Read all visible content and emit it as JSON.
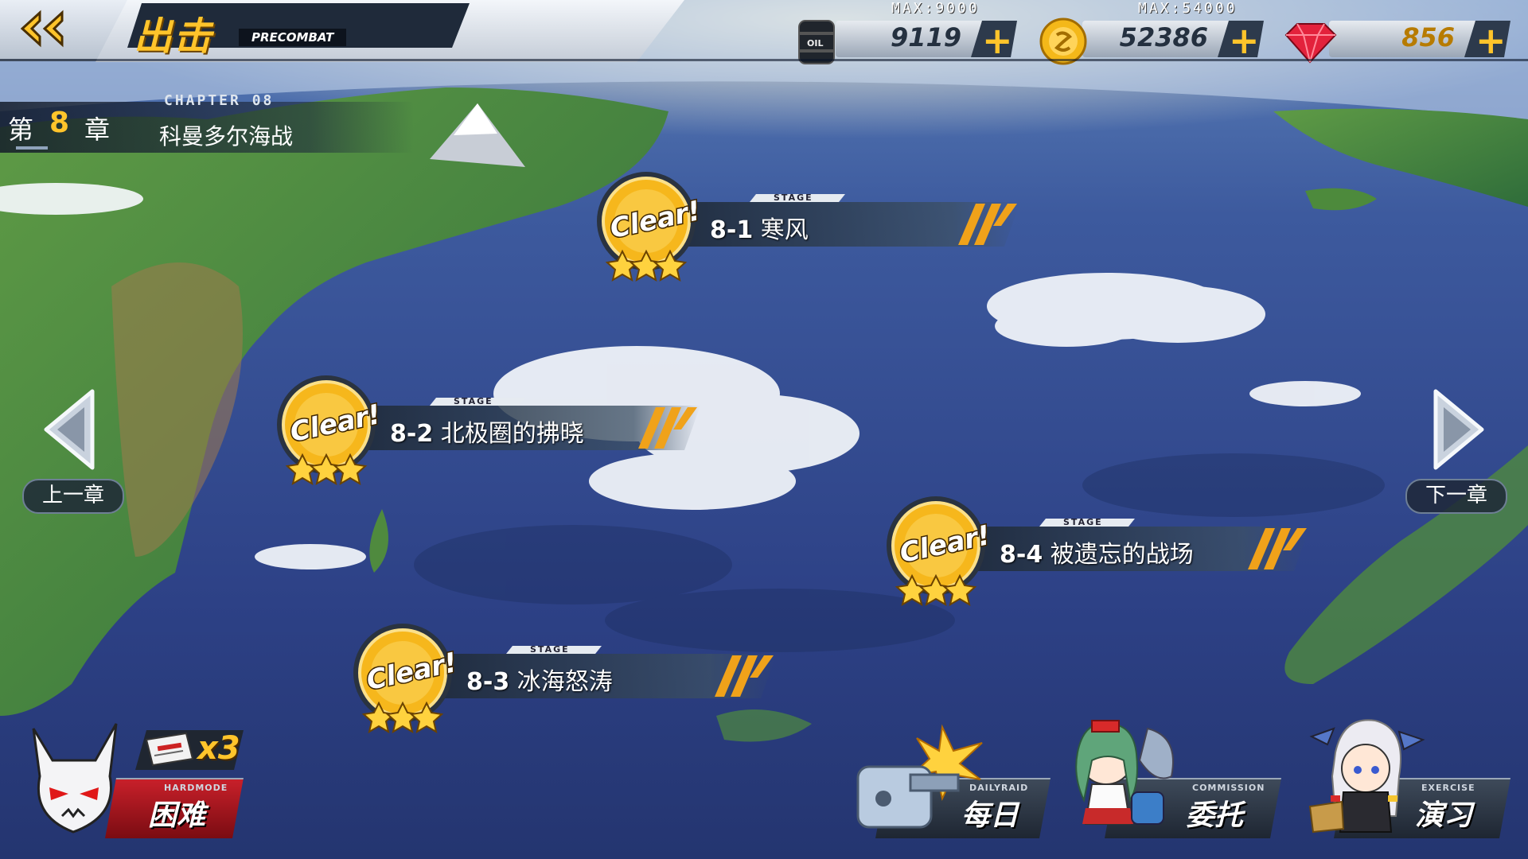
{
  "header": {
    "title": "出击",
    "subtitle": "PRECOMBAT"
  },
  "resources": {
    "oil": {
      "max": "MAX:9000",
      "value": "9119",
      "icon": "oil-barrel-icon"
    },
    "coin": {
      "max": "MAX:54000",
      "value": "52386",
      "icon": "gold-coin-icon"
    },
    "gem": {
      "max": "",
      "value": "856",
      "icon": "ruby-gem-icon"
    },
    "plus_label": "+"
  },
  "chapter": {
    "label_en": "CHAPTER 08",
    "prefix": "第",
    "number": "8",
    "suffix": "章",
    "name": "科曼多尔海战"
  },
  "stages": [
    {
      "tag": "STAGE",
      "code": "8-1",
      "name": "寒风",
      "status": "Clear!",
      "stars": 3
    },
    {
      "tag": "STAGE",
      "code": "8-2",
      "name": "北极圈的拂晓",
      "status": "Clear!",
      "stars": 3
    },
    {
      "tag": "STAGE",
      "code": "8-3",
      "name": "冰海怒涛",
      "status": "Clear!",
      "stars": 3
    },
    {
      "tag": "STAGE",
      "code": "8-4",
      "name": "被遗忘的战场",
      "status": "Clear!",
      "stars": 3
    }
  ],
  "navigation": {
    "prev_label": "上一章",
    "next_label": "下一章"
  },
  "bottom": {
    "hardmode": {
      "en": "HARDMODE",
      "cn": "困难",
      "tickets": "x3"
    },
    "daily": {
      "en": "DAILYRAID",
      "cn": "每日"
    },
    "commission": {
      "en": "COMMISSION",
      "cn": "委托"
    },
    "exercise": {
      "en": "EXERCISE",
      "cn": "演习"
    }
  },
  "colors": {
    "accent": "#ffc42b",
    "ocean": "#2b3f82",
    "hard_red": "#c8202a"
  }
}
